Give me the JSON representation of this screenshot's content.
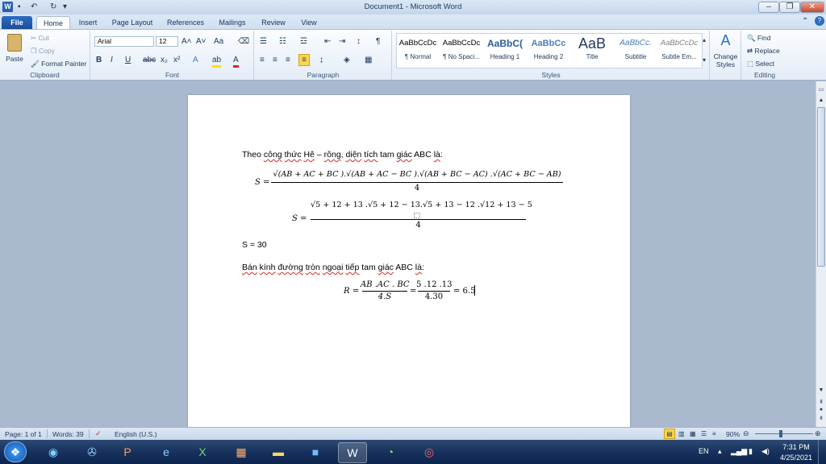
{
  "window": {
    "title": "Document1 - Microsoft Word",
    "quick_access": [
      "save-icon",
      "undo-icon",
      "redo-icon"
    ]
  },
  "tabs": [
    {
      "label": "File"
    },
    {
      "label": "Home"
    },
    {
      "label": "Insert"
    },
    {
      "label": "Page Layout"
    },
    {
      "label": "References"
    },
    {
      "label": "Mailings"
    },
    {
      "label": "Review"
    },
    {
      "label": "View"
    }
  ],
  "clipboard": {
    "paste": "Paste",
    "cut": "Cut",
    "copy": "Copy",
    "format_painter": "Format Painter",
    "group": "Clipboard"
  },
  "font": {
    "name": "Arial",
    "size": "12",
    "group": "Font"
  },
  "paragraph": {
    "group": "Paragraph"
  },
  "styles": {
    "items": [
      {
        "sample": "AaBbCcDc",
        "name": "¶ Normal"
      },
      {
        "sample": "AaBbCcDc",
        "name": "¶ No Spaci..."
      },
      {
        "sample": "AaBbC(",
        "name": "Heading 1"
      },
      {
        "sample": "AaBbCc",
        "name": "Heading 2"
      },
      {
        "sample": "AaB",
        "name": "Title"
      },
      {
        "sample": "AaBbCc.",
        "name": "Subtitle"
      },
      {
        "sample": "AaBbCcDc",
        "name": "Subtle Em..."
      }
    ],
    "change": "Change Styles",
    "group": "Styles"
  },
  "editing": {
    "find": "Find",
    "replace": "Replace",
    "select": "Select",
    "group": "Editing"
  },
  "document": {
    "line1_parts": [
      "Theo ",
      "công",
      " ",
      "thức",
      " ",
      "Hê",
      " – ",
      "rông",
      ", ",
      "diện",
      " ",
      "tích",
      " tam ",
      "giác",
      " ABC ",
      "là",
      ":"
    ],
    "formula1": {
      "lhs": "S =",
      "num": "√(AB + AC + BC ).√(AB + AC − BC ).√(AB + BC − AC) .√(AC + BC − AB)",
      "den": "4"
    },
    "formula2": {
      "lhs": "S =",
      "num": "√5 + 12 + 13 .√5 + 12 − 13.√5 + 13 − 12 .√12 + 13 − 5",
      "den": "4"
    },
    "result1": "S = 30",
    "line2_parts": [
      "Bán",
      " ",
      "kính",
      " ",
      "đường",
      " ",
      "tròn",
      " ",
      "ngoại",
      " ",
      "tiếp",
      " tam ",
      "giác",
      " ABC ",
      "là",
      ":"
    ],
    "formula3": {
      "lhs": "R =",
      "num1": "AB .AC . BC",
      "den1": "4.S",
      "eq": "=",
      "num2": "5 .12 .13",
      "den2": "4.30",
      "tail": "= 6.5"
    }
  },
  "status": {
    "page": "Page: 1 of 1",
    "words": "Words: 39",
    "language": "English (U.S.)",
    "zoom": "90%",
    "zoom_level": 0.9
  },
  "taskbar": {
    "lang": "EN",
    "time": "7:31 PM",
    "date": "4/25/2021"
  },
  "colors": {
    "file_tab": "#2c6bc0",
    "taskbar": "#15305a",
    "ribbon": "#e3ecf7"
  }
}
